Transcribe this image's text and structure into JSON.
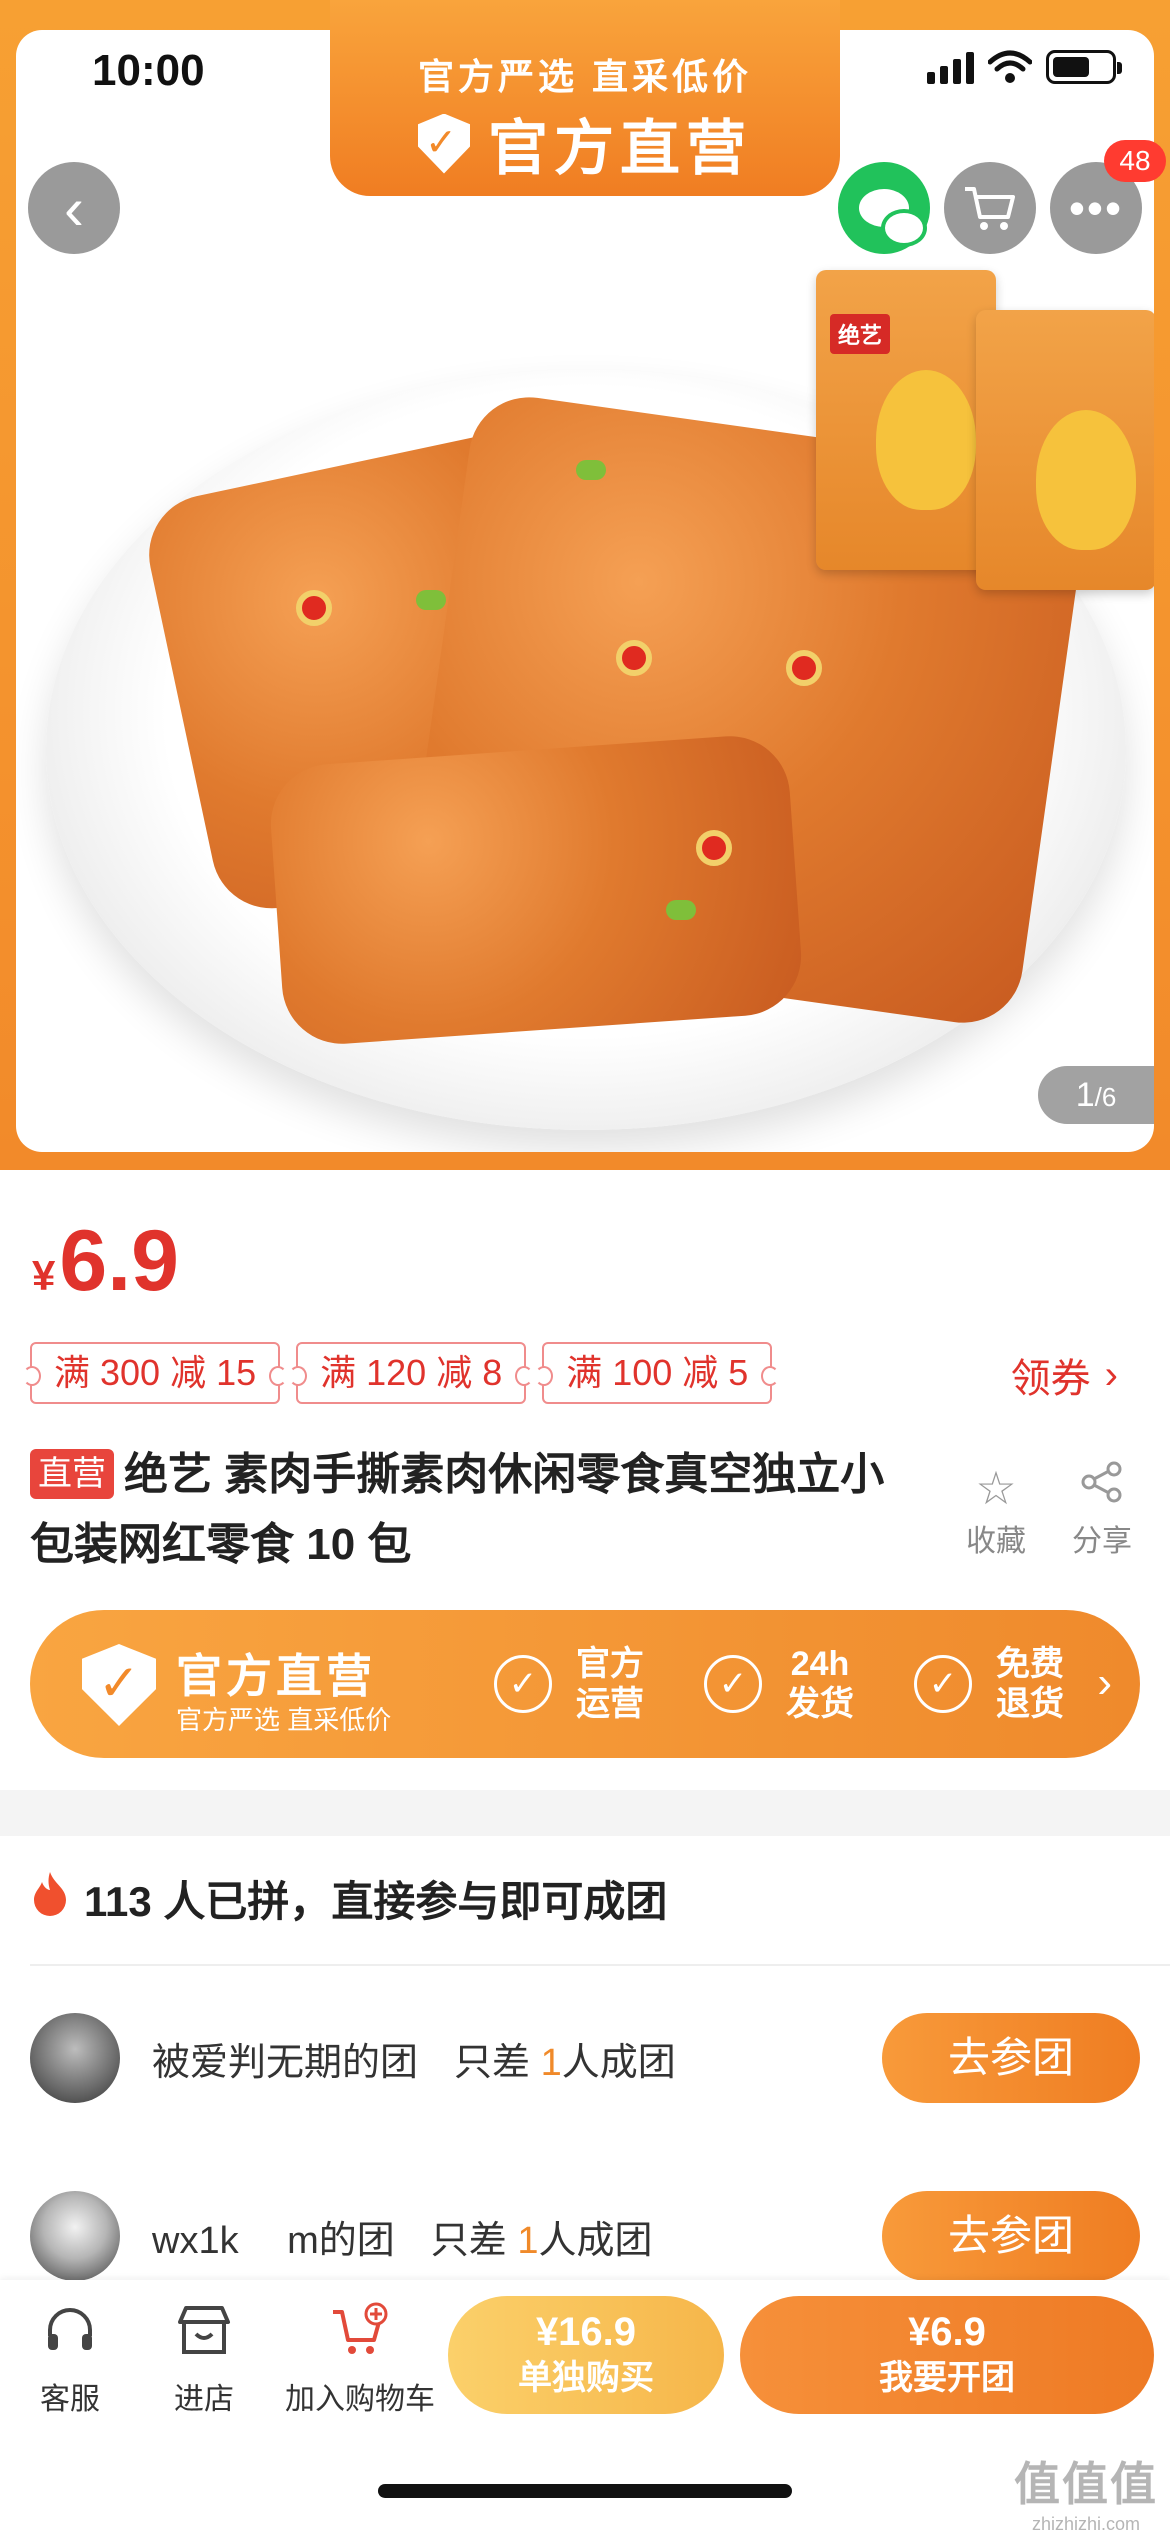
{
  "status_bar": {
    "time": "10:00"
  },
  "banner": {
    "line1": "官方严选 直采低价",
    "line2": "官方直营"
  },
  "top_actions": {
    "badge_count": "48"
  },
  "image_counter": {
    "current": "1",
    "total": "/6"
  },
  "product_pack": {
    "label": "绝艺"
  },
  "price": {
    "currency": "¥",
    "value": "6.9"
  },
  "coupons": [
    "满 300 减 15",
    "满 120 减 8",
    "满 100 减 5"
  ],
  "claim_coupon": {
    "label": "领券",
    "arrow": "›"
  },
  "product": {
    "tag": "直营",
    "title": "绝艺 素肉手撕素肉休闲零食真空独立小包装网红零食 10 包"
  },
  "actions": {
    "favorite": "收藏",
    "share": "分享"
  },
  "official_bar": {
    "title": "官方直营",
    "subtitle": "官方严选 直采低价",
    "features": [
      "官方运营",
      "24h发货",
      "免费退货"
    ],
    "check": "✓",
    "arrow": "›"
  },
  "group_buy": {
    "header": "113 人已拼，直接参与即可成团",
    "rows": [
      {
        "name": "被爱判无期的团",
        "need_prefix": "只差",
        "need_num": "1",
        "need_suffix": "人成团",
        "button": "去参团"
      },
      {
        "name": "wx1k　 m的团",
        "need_prefix": "只差",
        "need_num": "1",
        "need_suffix": "人成团",
        "button": "去参团"
      }
    ]
  },
  "bottom_bar": {
    "service": "客服",
    "store": "进店",
    "add_cart": "加入购物车",
    "solo_price": "¥16.9",
    "solo_label": "单独购买",
    "group_price": "¥6.9",
    "group_label": "我要开团"
  },
  "watermark": {
    "line1": "值值值",
    "line2": "zhizhizhi.com"
  },
  "colors": {
    "accent": "#f28a2a",
    "price_red": "#e0332c",
    "wechat_green": "#21c25b"
  }
}
